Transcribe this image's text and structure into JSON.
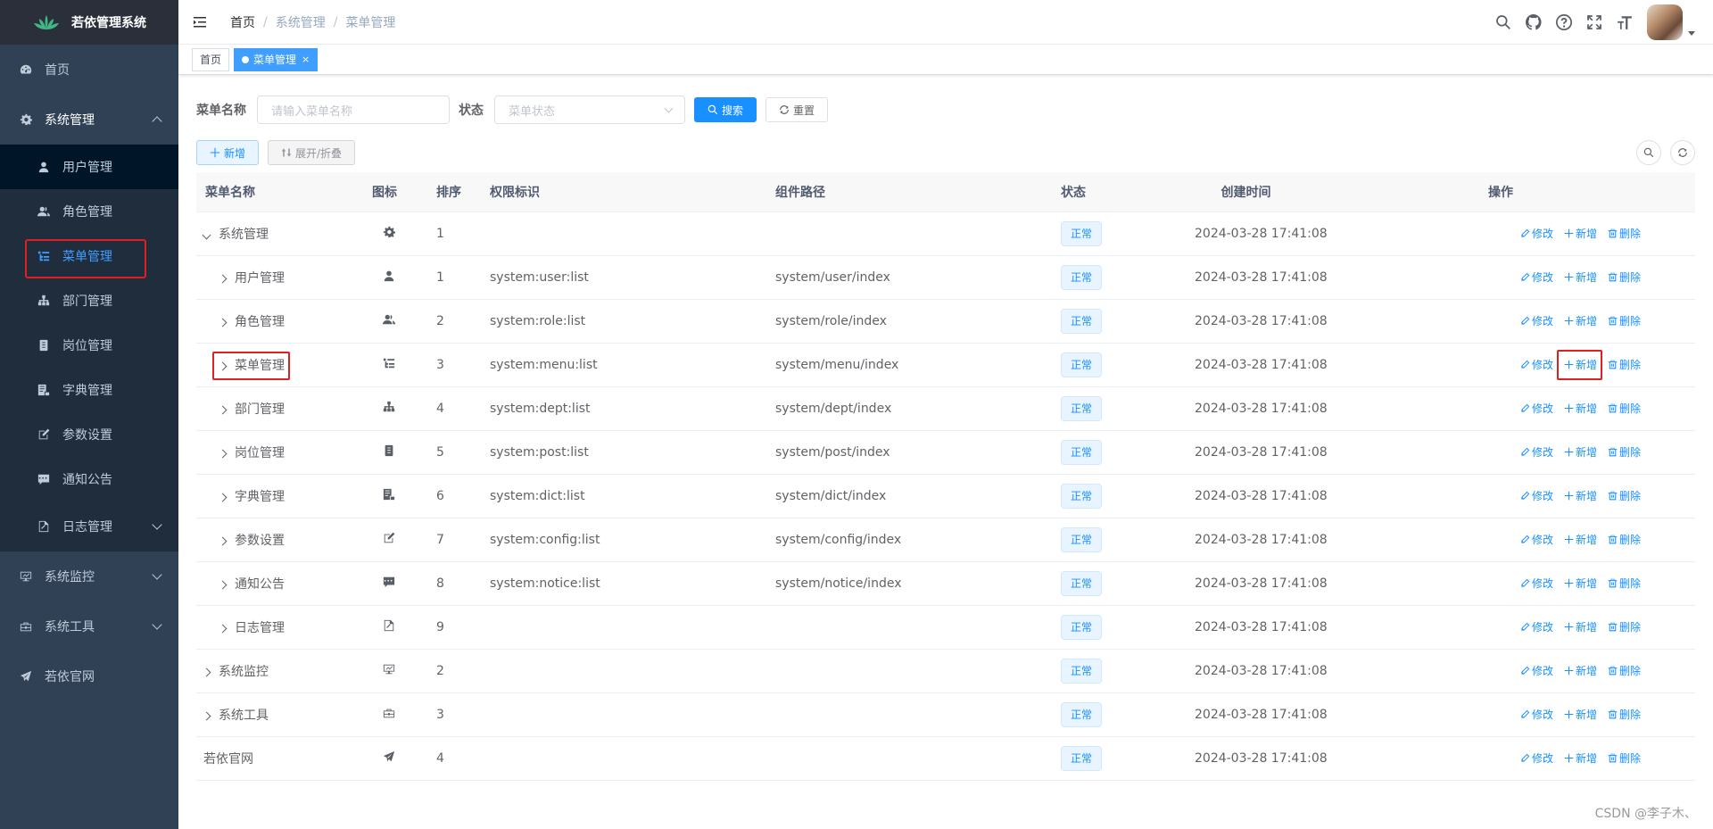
{
  "app": {
    "title": "若依管理系统"
  },
  "sidebar": {
    "items": [
      {
        "label": "首页",
        "icon": "dashboard-icon"
      },
      {
        "label": "系统管理",
        "icon": "gear-icon"
      },
      {
        "label": "系统监控",
        "icon": "monitor-icon"
      },
      {
        "label": "系统工具",
        "icon": "toolbox-icon"
      },
      {
        "label": "若依官网",
        "icon": "paper-plane-icon"
      }
    ],
    "system_sub": [
      {
        "label": "用户管理"
      },
      {
        "label": "角色管理"
      },
      {
        "label": "菜单管理"
      },
      {
        "label": "部门管理"
      },
      {
        "label": "岗位管理"
      },
      {
        "label": "字典管理"
      },
      {
        "label": "参数设置"
      },
      {
        "label": "通知公告"
      },
      {
        "label": "日志管理"
      }
    ]
  },
  "breadcrumb": [
    "首页",
    "系统管理",
    "菜单管理"
  ],
  "tags": {
    "home": "首页",
    "current": "菜单管理",
    "close": "×"
  },
  "search": {
    "name_label": "菜单名称",
    "name_placeholder": "请输入菜单名称",
    "status_label": "状态",
    "status_placeholder": "菜单状态",
    "search_btn": "搜索",
    "reset_btn": "重置"
  },
  "toolbar": {
    "add": "新增",
    "expand": "展开/折叠"
  },
  "table": {
    "headers": [
      "菜单名称",
      "图标",
      "排序",
      "权限标识",
      "组件路径",
      "状态",
      "创建时间",
      "操作"
    ],
    "ops": {
      "edit": "修改",
      "add": "新增",
      "del": "删除"
    },
    "rows": [
      {
        "name": "系统管理",
        "level": 0,
        "exp": "open",
        "icon": "gear-icon",
        "sort": "1",
        "perm": "",
        "comp": "",
        "status": "正常",
        "time": "2024-03-28 17:41:08"
      },
      {
        "name": "用户管理",
        "level": 1,
        "exp": "closed",
        "icon": "user-icon",
        "sort": "1",
        "perm": "system:user:list",
        "comp": "system/user/index",
        "status": "正常",
        "time": "2024-03-28 17:41:08"
      },
      {
        "name": "角色管理",
        "level": 1,
        "exp": "closed",
        "icon": "peoples-icon",
        "sort": "2",
        "perm": "system:role:list",
        "comp": "system/role/index",
        "status": "正常",
        "time": "2024-03-28 17:41:08"
      },
      {
        "name": "菜单管理",
        "level": 1,
        "exp": "closed",
        "icon": "tree-table-icon",
        "sort": "3",
        "perm": "system:menu:list",
        "comp": "system/menu/index",
        "status": "正常",
        "time": "2024-03-28 17:41:08"
      },
      {
        "name": "部门管理",
        "level": 1,
        "exp": "closed",
        "icon": "tree-icon",
        "sort": "4",
        "perm": "system:dept:list",
        "comp": "system/dept/index",
        "status": "正常",
        "time": "2024-03-28 17:41:08"
      },
      {
        "name": "岗位管理",
        "level": 1,
        "exp": "closed",
        "icon": "post-icon",
        "sort": "5",
        "perm": "system:post:list",
        "comp": "system/post/index",
        "status": "正常",
        "time": "2024-03-28 17:41:08"
      },
      {
        "name": "字典管理",
        "level": 1,
        "exp": "closed",
        "icon": "dict-icon",
        "sort": "6",
        "perm": "system:dict:list",
        "comp": "system/dict/index",
        "status": "正常",
        "time": "2024-03-28 17:41:08"
      },
      {
        "name": "参数设置",
        "level": 1,
        "exp": "closed",
        "icon": "edit-icon",
        "sort": "7",
        "perm": "system:config:list",
        "comp": "system/config/index",
        "status": "正常",
        "time": "2024-03-28 17:41:08"
      },
      {
        "name": "通知公告",
        "level": 1,
        "exp": "closed",
        "icon": "message-icon",
        "sort": "8",
        "perm": "system:notice:list",
        "comp": "system/notice/index",
        "status": "正常",
        "time": "2024-03-28 17:41:08"
      },
      {
        "name": "日志管理",
        "level": 1,
        "exp": "closed",
        "icon": "log-icon",
        "sort": "9",
        "perm": "",
        "comp": "",
        "status": "正常",
        "time": "2024-03-28 17:41:08"
      },
      {
        "name": "系统监控",
        "level": 0,
        "exp": "closed",
        "icon": "monitor-icon",
        "sort": "2",
        "perm": "",
        "comp": "",
        "status": "正常",
        "time": "2024-03-28 17:41:08"
      },
      {
        "name": "系统工具",
        "level": 0,
        "exp": "closed",
        "icon": "toolbox-icon",
        "sort": "3",
        "perm": "",
        "comp": "",
        "status": "正常",
        "time": "2024-03-28 17:41:08"
      },
      {
        "name": "若依官网",
        "level": 0,
        "exp": "none",
        "icon": "paper-plane-icon",
        "sort": "4",
        "perm": "",
        "comp": "",
        "status": "正常",
        "time": "2024-03-28 17:41:08"
      }
    ]
  },
  "watermark": "CSDN @李子木、",
  "colors": {
    "sidebar_bg": "#304156",
    "primary": "#1890ff",
    "highlight": "#e02020"
  }
}
